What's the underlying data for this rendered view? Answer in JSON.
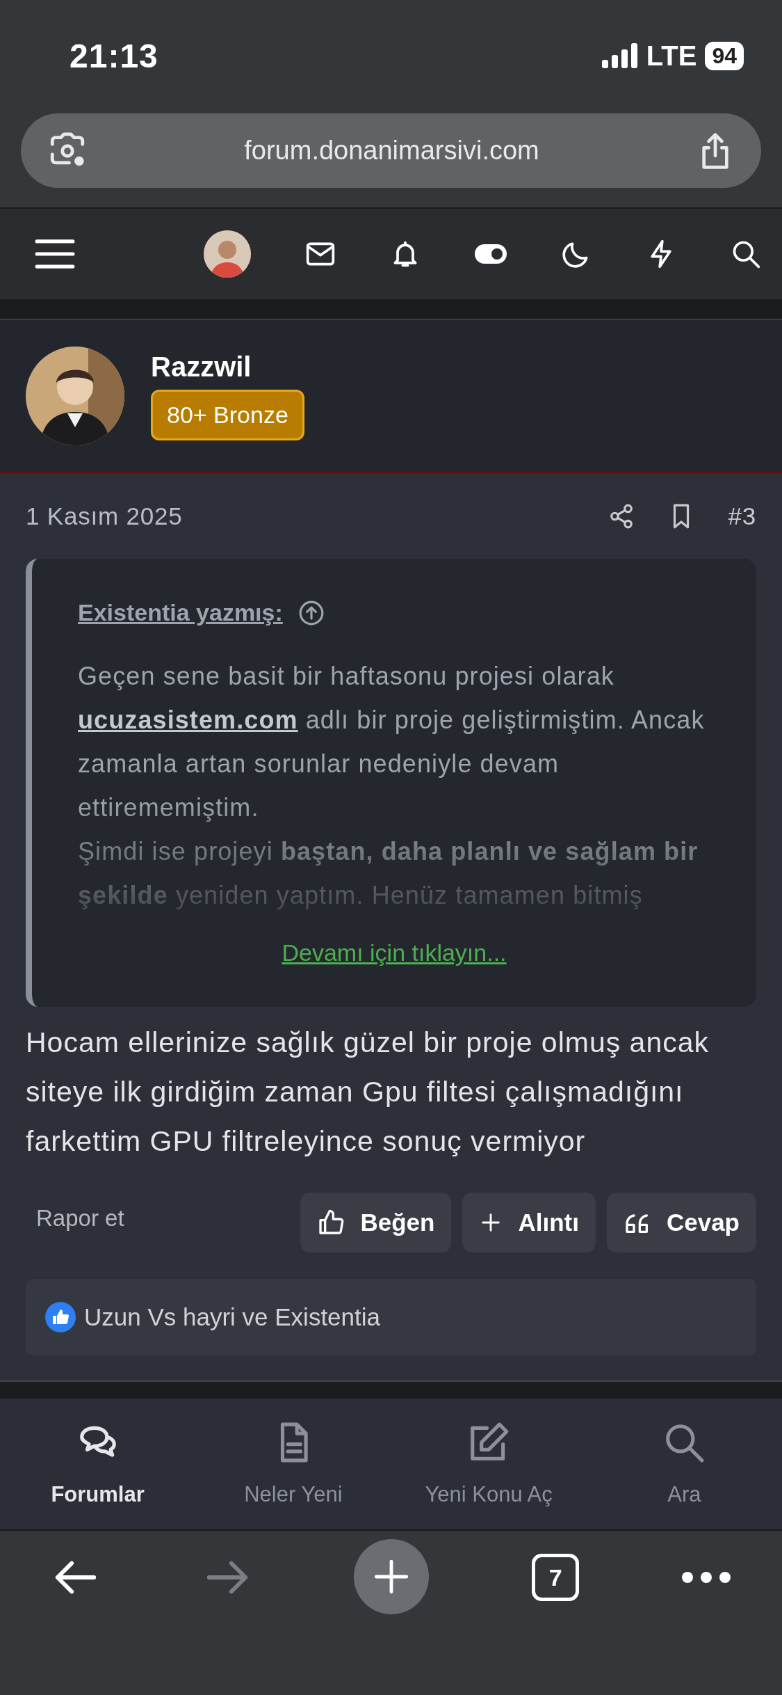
{
  "status_bar": {
    "time": "21:13",
    "network": "LTE",
    "battery": "94"
  },
  "address_bar": {
    "url": "forum.donanimarsivi.com"
  },
  "post": {
    "author": {
      "name": "Razzwil",
      "badge": "80+ Bronze"
    },
    "date": "1 Kasım 2025",
    "number": "#3",
    "quote": {
      "author": "Existentia yazmış:",
      "paragraph_1": {
        "before": "Geçen sene basit bir haftasonu projesi olarak ",
        "link": "ucuzasistem.com",
        "after": " adlı bir proje geliştirmiştim. Ancak zamanla artan sorunlar nedeniyle devam ettirememiştim."
      },
      "paragraph_2": "Şimdi ise projeyi **baştan, daha planlı ve sağlam bir şekilde** yeniden yaptım. Henüz tamamen bitmiş",
      "expand_link": "Devamı için tıklayın..."
    },
    "body": "Hocam ellerinize sağlık güzel bir proje olmuş ancak siteye ilk girdiğim zaman Gpu filtesi çalışmadığını farkettim GPU filtreleyince sonuç vermiyor",
    "report": "Rapor et",
    "actions": [
      {
        "kind": "like",
        "label": "Beğen"
      },
      {
        "kind": "quote",
        "label": "Alıntı"
      },
      {
        "kind": "reply",
        "label": "Cevap"
      }
    ],
    "reactions": "Uzun Vs hayri ve Existentia"
  },
  "bottom_nav": [
    {
      "kind": "forums",
      "label": "Forumlar",
      "selected": true
    },
    {
      "kind": "new",
      "label": "Neler Yeni",
      "selected": false
    },
    {
      "kind": "post",
      "label": "Yeni Konu Aç",
      "selected": false
    },
    {
      "kind": "search",
      "label": "Ara",
      "selected": false
    }
  ],
  "browser_toolbar": {
    "tab_count": "7",
    "forward_disabled": true
  }
}
